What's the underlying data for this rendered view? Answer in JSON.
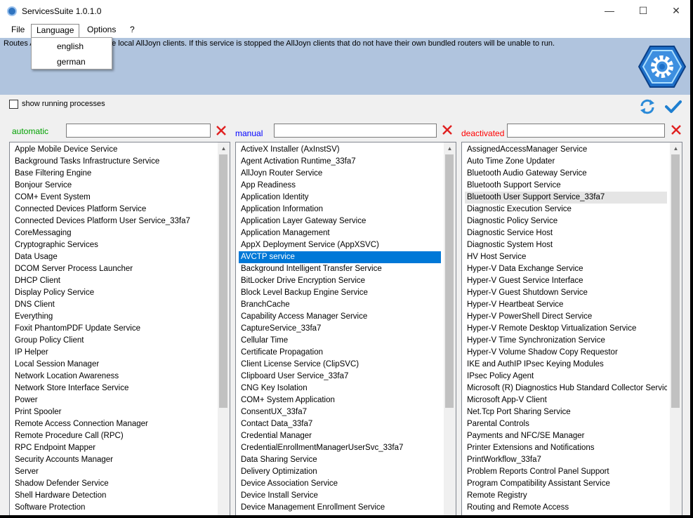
{
  "window": {
    "title": "ServicesSuite 1.0.1.0",
    "controls": {
      "minimize": "—",
      "maximize": "☐",
      "close": "✕"
    }
  },
  "menu": {
    "file": "File",
    "language": "Language",
    "options": "Options",
    "help": "?",
    "language_dropdown": [
      "english",
      "german"
    ]
  },
  "banner": {
    "description": "Routes AllJoyn messages for the local AllJoyn clients. If this service is stopped the AllJoyn clients that do not have their own bundled routers will be unable to run.",
    "logo_icon": "gear-hexagon-icon"
  },
  "options": {
    "show_running_processes": "show running processes",
    "checked": false
  },
  "toolbar": {
    "refresh_icon": "refresh-icon",
    "apply_icon": "checkmark-icon"
  },
  "colors": {
    "automatic": "#00a000",
    "manual": "#0000ff",
    "deactivated": "#ff0000",
    "clear": "#e02020",
    "selection": "#0078d7",
    "banner": "#b0c4de"
  },
  "columns": {
    "automatic": {
      "label": "automatic",
      "filter_value": "",
      "scroll_position": 0,
      "items": [
        "Apple Mobile Device Service",
        "Background Tasks Infrastructure Service",
        "Base Filtering Engine",
        "Bonjour Service",
        "COM+ Event System",
        "Connected Devices Platform Service",
        "Connected Devices Platform User Service_33fa7",
        "CoreMessaging",
        "Cryptographic Services",
        "Data Usage",
        "DCOM Server Process Launcher",
        "DHCP Client",
        "Display Policy Service",
        "DNS Client",
        "Everything",
        "Foxit PhantomPDF Update Service",
        "Group Policy Client",
        "IP Helper",
        "Local Session Manager",
        "Network Location Awareness",
        "Network Store Interface Service",
        "Power",
        "Print Spooler",
        "Remote Access Connection Manager",
        "Remote Procedure Call (RPC)",
        "RPC Endpoint Mapper",
        "Security Accounts Manager",
        "Server",
        "Shadow Defender Service",
        "Shell Hardware Detection",
        "Software Protection"
      ]
    },
    "manual": {
      "label": "manual",
      "filter_value": "",
      "scroll_position": 0,
      "selected": "AVCTP service",
      "items": [
        "ActiveX Installer (AxInstSV)",
        "Agent Activation Runtime_33fa7",
        "AllJoyn Router Service",
        "App Readiness",
        "Application Identity",
        "Application Information",
        "Application Layer Gateway Service",
        "Application Management",
        "AppX Deployment Service (AppXSVC)",
        "AVCTP service",
        "Background Intelligent Transfer Service",
        "BitLocker Drive Encryption Service",
        "Block Level Backup Engine Service",
        "BranchCache",
        "Capability Access Manager Service",
        "CaptureService_33fa7",
        "Cellular Time",
        "Certificate Propagation",
        "Client License Service (ClipSVC)",
        "Clipboard User Service_33fa7",
        "CNG Key Isolation",
        "COM+ System Application",
        "ConsentUX_33fa7",
        "Contact Data_33fa7",
        "Credential Manager",
        "CredentialEnrollmentManagerUserSvc_33fa7",
        "Data Sharing Service",
        "Delivery Optimization",
        "Device Association Service",
        "Device Install Service",
        "Device Management Enrollment Service"
      ]
    },
    "deactivated": {
      "label": "deactivated",
      "filter_value": "",
      "scroll_position": 0,
      "hovered": "Bluetooth User Support Service_33fa7",
      "items": [
        "AssignedAccessManager Service",
        "Auto Time Zone Updater",
        "Bluetooth Audio Gateway Service",
        "Bluetooth Support Service",
        "Bluetooth User Support Service_33fa7",
        "Diagnostic Execution Service",
        "Diagnostic Policy Service",
        "Diagnostic Service Host",
        "Diagnostic System Host",
        "HV Host Service",
        "Hyper-V Data Exchange Service",
        "Hyper-V Guest Service Interface",
        "Hyper-V Guest Shutdown Service",
        "Hyper-V Heartbeat Service",
        "Hyper-V PowerShell Direct Service",
        "Hyper-V Remote Desktop Virtualization Service",
        "Hyper-V Time Synchronization Service",
        "Hyper-V Volume Shadow Copy Requestor",
        "IKE and AuthIP IPsec Keying Modules",
        "IPsec Policy Agent",
        "Microsoft (R) Diagnostics Hub Standard Collector Service",
        "Microsoft App-V Client",
        "Net.Tcp Port Sharing Service",
        "Parental Controls",
        "Payments and NFC/SE Manager",
        "Printer Extensions and Notifications",
        "PrintWorkflow_33fa7",
        "Problem Reports Control Panel Support",
        "Program Compatibility Assistant Service",
        "Remote Registry",
        "Routing and Remote Access"
      ]
    }
  }
}
